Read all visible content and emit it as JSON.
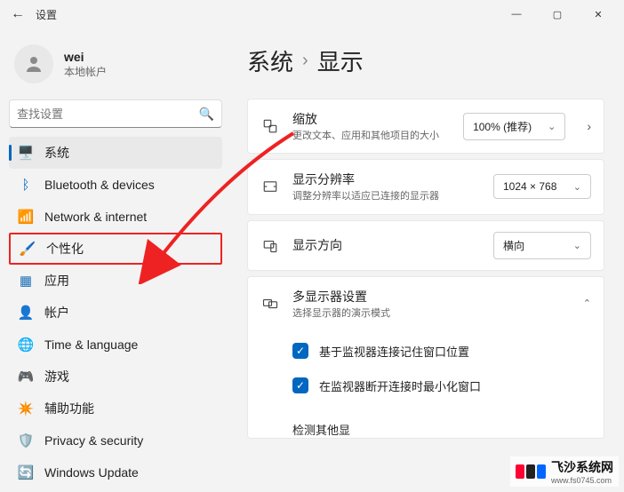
{
  "titlebar": {
    "title": "设置"
  },
  "profile": {
    "name": "wei",
    "subtitle": "本地帐户"
  },
  "search": {
    "placeholder": "查找设置"
  },
  "nav": {
    "items": [
      {
        "label": "系统",
        "icon": "monitor-icon",
        "color": "#0067c0"
      },
      {
        "label": "Bluetooth & devices",
        "icon": "bluetooth-icon",
        "color": "#0067c0"
      },
      {
        "label": "Network & internet",
        "icon": "wifi-icon",
        "color": "#00a2ed"
      },
      {
        "label": "个性化",
        "icon": "brush-icon",
        "color": "#c06518"
      },
      {
        "label": "应用",
        "icon": "apps-icon",
        "color": "#1a6fb8"
      },
      {
        "label": "帐户",
        "icon": "person-icon",
        "color": "#3a7a3a"
      },
      {
        "label": "Time & language",
        "icon": "globe-icon",
        "color": "#0a82c3"
      },
      {
        "label": "游戏",
        "icon": "gamepad-icon",
        "color": "#777"
      },
      {
        "label": "辅助功能",
        "icon": "accessibility-icon",
        "color": "#2a6fd0"
      },
      {
        "label": "Privacy & security",
        "icon": "shield-icon",
        "color": "#555"
      },
      {
        "label": "Windows Update",
        "icon": "update-icon",
        "color": "#0a82c3"
      }
    ]
  },
  "breadcrumb": {
    "parent": "系统",
    "current": "显示"
  },
  "settings": {
    "scale": {
      "title": "缩放",
      "desc": "更改文本、应用和其他项目的大小",
      "value": "100% (推荐)"
    },
    "resolution": {
      "title": "显示分辨率",
      "desc": "调整分辨率以适应已连接的显示器",
      "value": "1024 × 768"
    },
    "orientation": {
      "title": "显示方向",
      "value": "横向"
    },
    "multi": {
      "title": "多显示器设置",
      "desc": "选择显示器的演示模式",
      "opt1": "基于监视器连接记住窗口位置",
      "opt2": "在监视器断开连接时最小化窗口",
      "last": "检测其他显"
    }
  },
  "watermark": {
    "brand": "飞沙系统网",
    "url": "www.fs0745.com"
  }
}
